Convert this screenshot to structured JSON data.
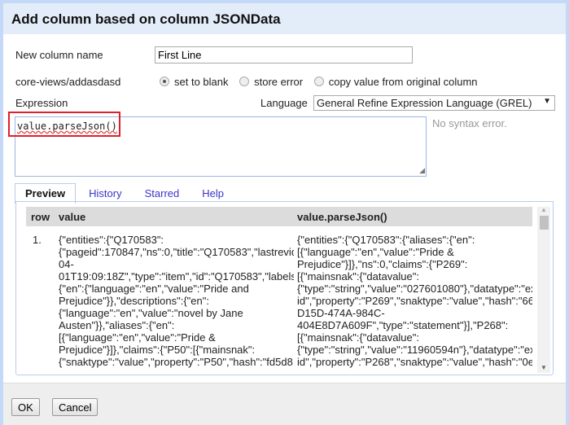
{
  "title": "Add column based on column JSONData",
  "new_column_label": "New column name",
  "new_column_value": "First Line",
  "on_error_label": "core-views/addasdasd",
  "on_error_options": [
    {
      "label": "set to blank",
      "selected": true
    },
    {
      "label": "store error",
      "selected": false
    },
    {
      "label": "copy value from original column",
      "selected": false
    }
  ],
  "expression_label": "Expression",
  "language_label": "Language",
  "language_value": "General Refine Expression Language (GREL)",
  "expression": "value.parseJson()",
  "syntax_status": "No syntax error.",
  "tabs": [
    "Preview",
    "History",
    "Starred",
    "Help"
  ],
  "preview": {
    "columns": [
      "row",
      "value",
      "value.parseJson()"
    ],
    "rows": [
      {
        "row": "1.",
        "value_lines": [
          "{\"entities\":{\"Q170583\":",
          "{\"pageid\":170847,\"ns\":0,\"title\":\"Q170583\",\"lastrevid",
          "04-",
          "01T19:09:18Z\",\"type\":\"item\",\"id\":\"Q170583\",\"labels",
          "{\"en\":{\"language\":\"en\",\"value\":\"Pride and",
          "Prejudice\"}},\"descriptions\":{\"en\":",
          "{\"language\":\"en\",\"value\":\"novel by Jane",
          "Austen\"}},\"aliases\":{\"en\":",
          "[{\"language\":\"en\",\"value\":\"Pride &",
          "Prejudice\"}]},\"claims\":{\"P50\":[{\"mainsnak\":",
          "{\"snaktype\":\"value\",\"property\":\"P50\",\"hash\":\"fd5d8"
        ],
        "result_lines": [
          "{\"entities\":{\"Q170583\":{\"aliases\":{\"en\":",
          "[{\"language\":\"en\",\"value\":\"Pride &",
          "Prejudice\"}]},\"ns\":0,\"claims\":{\"P269\":",
          "[{\"mainsnak\":{\"datavalue\":",
          "{\"type\":\"string\",\"value\":\"027601080\"},\"datatype\":\"ex",
          "id\",\"property\":\"P269\",\"snaktype\":\"value\",\"hash\":\"66",
          "D15D-474A-984C-",
          "404E8D7A609F\",\"type\":\"statement\"}],\"P268\":",
          "[{\"mainsnak\":{\"datavalue\":",
          "{\"type\":\"string\",\"value\":\"11960594n\"},\"datatype\":\"ex",
          "id\",\"property\":\"P268\",\"snaktype\":\"value\",\"hash\":\"0e"
        ]
      }
    ]
  },
  "buttons": {
    "ok": "OK",
    "cancel": "Cancel"
  },
  "colors": {
    "highlight_box": "#e0202a",
    "title_bg": "#e3edfa",
    "tab_link": "#3a35c8"
  }
}
